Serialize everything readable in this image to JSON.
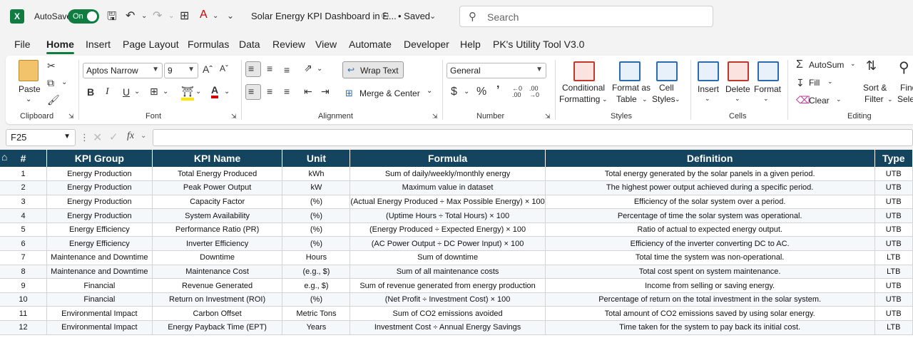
{
  "titlebar": {
    "app_logo": "X",
    "autosave_label": "AutoSave",
    "toggle_state": "On",
    "doc_title": "Solar Energy KPI Dashboard in E...",
    "saved_status": "• Saved",
    "search_placeholder": "Search"
  },
  "menu": {
    "tabs": [
      "File",
      "Home",
      "Insert",
      "Page Layout",
      "Formulas",
      "Data",
      "Review",
      "View",
      "Automate",
      "Developer",
      "Help",
      "PK's Utility Tool V3.0"
    ],
    "active": "Home"
  },
  "ribbon": {
    "clipboard": {
      "paste_label": "Paste",
      "group_label": "Clipboard"
    },
    "font": {
      "font_name": "Aptos Narrow",
      "font_size": "9",
      "group_label": "Font"
    },
    "alignment": {
      "wrap_text": "Wrap Text",
      "merge_center": "Merge & Center",
      "group_label": "Alignment"
    },
    "number": {
      "format": "General",
      "group_label": "Number"
    },
    "styles": {
      "conditional": "Conditional",
      "formatting": "Formatting",
      "format_as": "Format as",
      "table": "Table",
      "cell": "Cell",
      "styles": "Styles",
      "group_label": "Styles"
    },
    "cells": {
      "insert": "Insert",
      "delete": "Delete",
      "format": "Format",
      "group_label": "Cells"
    },
    "editing": {
      "autosum": "AutoSum",
      "fill": "Fill",
      "clear": "Clear",
      "sort": "Sort &",
      "filter": "Filter",
      "find": "Find",
      "select": "Selec",
      "group_label": "Editing"
    }
  },
  "formula_bar": {
    "cell_ref": "F25",
    "fx": "fx",
    "value": ""
  },
  "sheet": {
    "headers": [
      "#",
      "KPI Group",
      "KPI Name",
      "Unit",
      "Formula",
      "Definition",
      "Type"
    ],
    "rows": [
      [
        "1",
        "Energy Production",
        "Total Energy Produced",
        "kWh",
        "Sum of daily/weekly/monthly energy",
        "Total energy generated by the solar panels in a given period.",
        "UTB"
      ],
      [
        "2",
        "Energy Production",
        "Peak Power Output",
        "kW",
        "Maximum value in dataset",
        "The highest power output achieved during a specific period.",
        "UTB"
      ],
      [
        "3",
        "Energy Production",
        "Capacity Factor",
        "(%)",
        "(Actual Energy Produced ÷ Max Possible Energy) × 100",
        "Efficiency of the solar system over a period.",
        "UTB"
      ],
      [
        "4",
        "Energy Production",
        "System Availability",
        "(%)",
        "(Uptime Hours ÷ Total Hours) × 100",
        "Percentage of time the solar system was operational.",
        "UTB"
      ],
      [
        "5",
        "Energy Efficiency",
        "Performance Ratio (PR)",
        "(%)",
        "(Energy Produced ÷ Expected Energy) × 100",
        "Ratio of actual to expected energy output.",
        "UTB"
      ],
      [
        "6",
        "Energy Efficiency",
        "Inverter Efficiency",
        "(%)",
        "(AC Power Output ÷ DC Power Input) × 100",
        "Efficiency of the inverter converting DC to AC.",
        "UTB"
      ],
      [
        "7",
        "Maintenance and Downtime",
        "Downtime",
        "Hours",
        "Sum of downtime",
        "Total time the system was non-operational.",
        "LTB"
      ],
      [
        "8",
        "Maintenance and Downtime",
        "Maintenance Cost",
        "(e.g., $)",
        "Sum of all maintenance costs",
        "Total cost spent on system maintenance.",
        "LTB"
      ],
      [
        "9",
        "Financial",
        "Revenue Generated",
        "e.g., $)",
        "Sum of revenue generated from energy production",
        "Income from selling or saving energy.",
        "UTB"
      ],
      [
        "10",
        "Financial",
        "Return on Investment (ROI)",
        "(%)",
        "(Net Profit ÷ Investment Cost) × 100",
        "Percentage of return on the total investment in the solar system.",
        "UTB"
      ],
      [
        "11",
        "Environmental Impact",
        "Carbon Offset",
        "Metric Tons",
        "Sum of CO2 emissions avoided",
        "Total amount of CO2 emissions saved by using solar energy.",
        "UTB"
      ],
      [
        "12",
        "Environmental Impact",
        "Energy Payback Time (EPT)",
        "Years",
        "Investment Cost ÷ Annual Energy Savings",
        "Time taken for the system to pay back its initial cost.",
        "LTB"
      ]
    ]
  },
  "colors": {
    "header_bg": "#14445e",
    "excel_green": "#107c41"
  }
}
